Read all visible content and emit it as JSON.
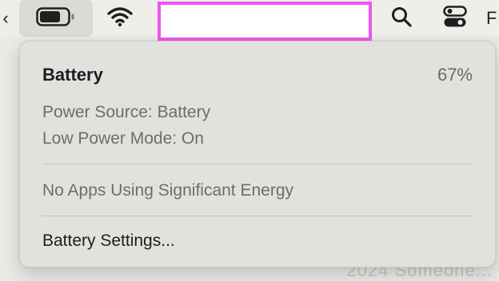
{
  "menubar": {
    "left_edge_glyph": "‹",
    "right_edge_glyph": "F",
    "icons": {
      "battery": "battery-icon",
      "wifi": "wifi-icon",
      "search": "search-icon",
      "control_center": "control-center-icon"
    },
    "redaction_color": "#ef55ef"
  },
  "battery_menu": {
    "title": "Battery",
    "percent": "67%",
    "power_source": "Power Source: Battery",
    "low_power_mode": "Low Power Mode: On",
    "energy_status": "No Apps Using Significant Energy",
    "settings_label": "Battery Settings..."
  },
  "desktop": {
    "hint_text": "2024 Someone..."
  }
}
